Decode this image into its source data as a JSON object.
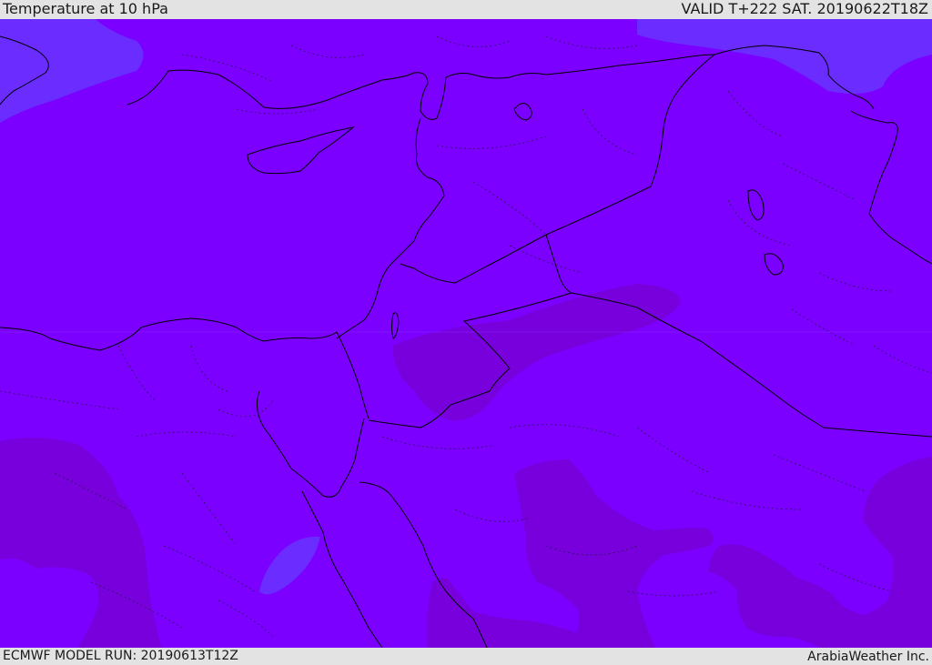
{
  "header": {
    "title": "Temperature at 10 hPa",
    "valid": "VALID T+222 SAT. 20190622T18Z"
  },
  "footer": {
    "model_run": "ECMWF MODEL RUN: 20190613T12Z",
    "brand": "ArabiaWeather Inc."
  },
  "colors": {
    "base": "#7b00ff",
    "warm": "#7700dd",
    "cool": "#6a2cff",
    "coast": "#000000"
  }
}
